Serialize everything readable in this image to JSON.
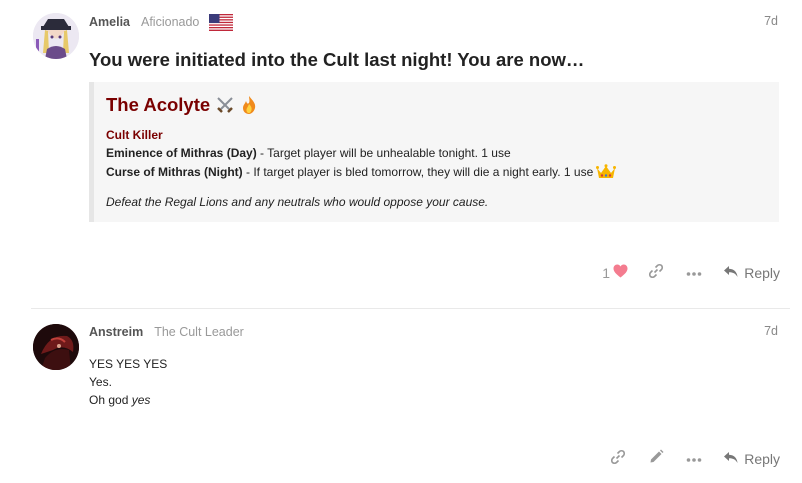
{
  "posts": [
    {
      "username": "Amelia",
      "user_title": "Aficionado",
      "age": "7d",
      "title": "You were initiated into the Cult last night! You are now…",
      "quote": {
        "role_name": "The Acolyte",
        "faction_label": "Cult Killer",
        "ability1_name": "Eminence of Mithras (Day)",
        "ability1_text": " - Target player will be unhealable tonight. 1 use",
        "ability2_name": "Curse of Mithras (Night)",
        "ability2_text": " - If target player is bled tomorrow, they will die a night early. 1 use",
        "goal": "Defeat the Regal Lions and any neutrals who would oppose your cause."
      },
      "like_count": "1",
      "reply_label": "Reply"
    },
    {
      "username": "Anstreim",
      "user_title": "The Cult Leader",
      "age": "7d",
      "body_line1": "YES YES YES",
      "body_line2": "Yes.",
      "body_line3_prefix": "Oh god ",
      "body_line3_em": "yes",
      "reply_label": "Reply"
    }
  ],
  "colors": {
    "role_red": "#7a0000",
    "like_heart": "#f47c8f",
    "muted": "#999999"
  },
  "icons": {
    "flag": "us-flag-icon",
    "role_emoji_1": "crossed-swords-icon",
    "role_emoji_2": "fire-icon",
    "crown": "crown-icon",
    "like": "heart-icon",
    "link": "link-icon",
    "edit": "pencil-icon",
    "more": "ellipsis-icon",
    "reply": "reply-arrow-icon"
  }
}
